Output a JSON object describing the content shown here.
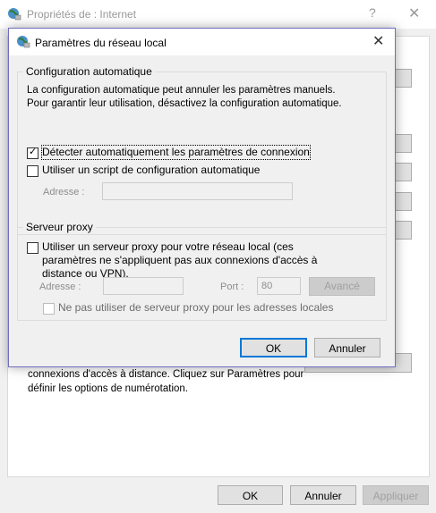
{
  "parent": {
    "title": "Propriétés de : Internet",
    "help_glyph": "?",
    "close_glyph": "✕",
    "body_text": "connexions d'accès à distance. Cliquez sur Paramètres pour définir les options de numérotation.",
    "buttons": {
      "ok": "OK",
      "cancel": "Annuler",
      "apply": "Appliquer"
    }
  },
  "dialog": {
    "title": "Paramètres du réseau local",
    "close_glyph": "✕",
    "auto_config": {
      "legend": "Configuration automatique",
      "description": "La configuration automatique peut annuler les paramètres manuels. Pour garantir leur utilisation, désactivez la configuration automatique.",
      "detect_label": "Détecter automatiquement les paramètres de connexion",
      "detect_checked": true,
      "script_label": "Utiliser un script de configuration automatique",
      "script_checked": false,
      "address_label": "Adresse :",
      "address_value": ""
    },
    "proxy": {
      "legend": "Serveur proxy",
      "use_proxy_label": "Utiliser un serveur proxy pour votre réseau local (ces paramètres ne s'appliquent pas aux connexions d'accès à distance ou VPN).",
      "use_proxy_checked": false,
      "address_label": "Adresse :",
      "address_value": "",
      "port_label": "Port :",
      "port_value": "80",
      "advanced_label": "Avancé",
      "bypass_label": "Ne pas utiliser de serveur proxy pour les adresses locales",
      "bypass_checked": false
    },
    "buttons": {
      "ok": "OK",
      "cancel": "Annuler"
    }
  }
}
